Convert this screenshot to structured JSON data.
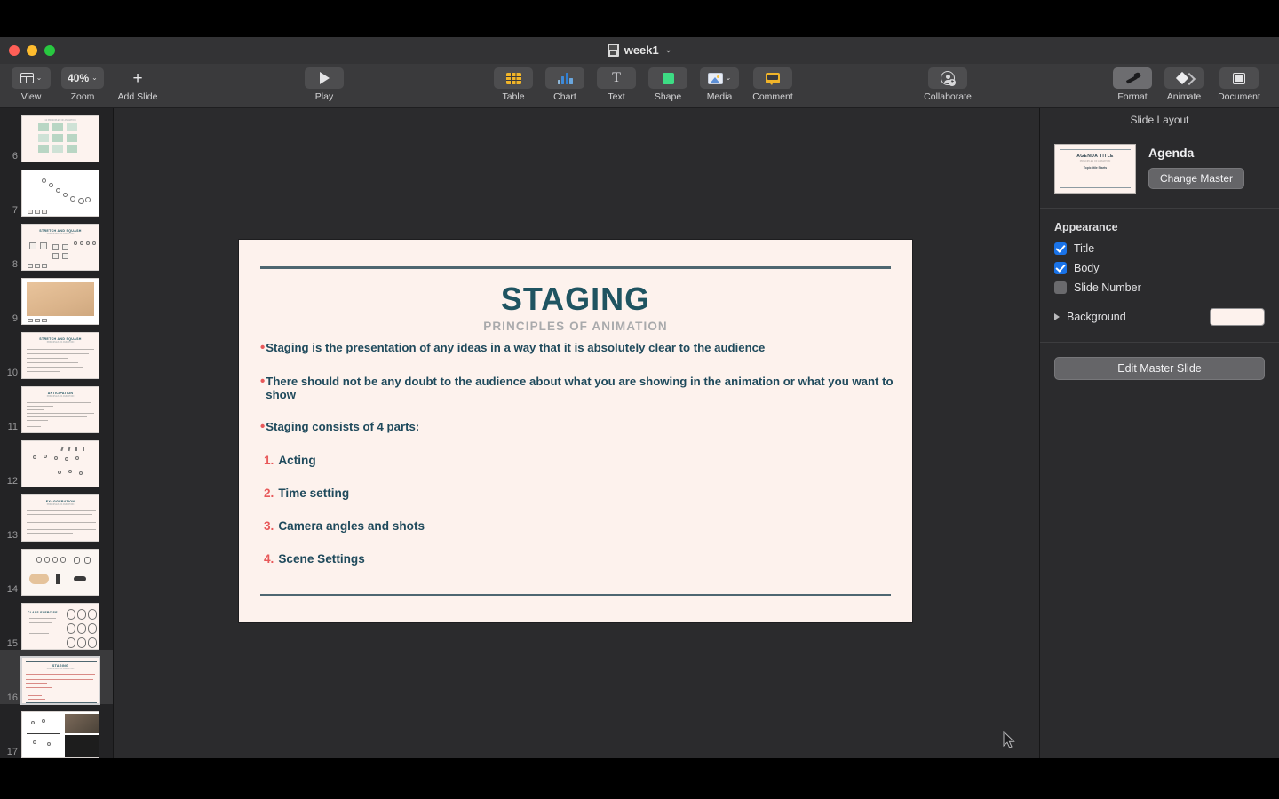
{
  "window": {
    "document_title": "week1",
    "title_chevron": "⌄"
  },
  "toolbar": {
    "left": [
      {
        "name": "view",
        "label": "View",
        "icon": "layout-icon",
        "has_chevron": true
      },
      {
        "name": "zoom",
        "label": "Zoom",
        "value": "40%",
        "icon": "zoom-value",
        "has_chevron": true
      },
      {
        "name": "add-slide",
        "label": "Add Slide",
        "icon": "plus-icon",
        "has_chevron": false
      }
    ],
    "play": {
      "label": "Play",
      "icon": "play-icon"
    },
    "insert": [
      {
        "name": "table",
        "label": "Table",
        "icon": "table-icon",
        "has_chevron": false
      },
      {
        "name": "chart",
        "label": "Chart",
        "icon": "chart-icon",
        "has_chevron": false
      },
      {
        "name": "text",
        "label": "Text",
        "icon": "text-icon",
        "has_chevron": false
      },
      {
        "name": "shape",
        "label": "Shape",
        "icon": "shape-icon",
        "has_chevron": false
      },
      {
        "name": "media",
        "label": "Media",
        "icon": "media-icon",
        "has_chevron": true
      },
      {
        "name": "comment",
        "label": "Comment",
        "icon": "comment-icon",
        "has_chevron": false
      }
    ],
    "collaborate": {
      "label": "Collaborate",
      "icon": "collaborate-icon"
    },
    "right": [
      {
        "name": "format",
        "label": "Format",
        "icon": "format-brush-icon",
        "active": true
      },
      {
        "name": "animate",
        "label": "Animate",
        "icon": "animate-diamond-icon",
        "active": false
      },
      {
        "name": "document",
        "label": "Document",
        "icon": "document-icon",
        "active": false
      }
    ]
  },
  "navigator": {
    "slides": [
      {
        "number": "6",
        "kind": "grid-icons",
        "title": ""
      },
      {
        "number": "7",
        "kind": "sketch-arc",
        "title": ""
      },
      {
        "number": "8",
        "kind": "titled-diagram",
        "title": "STRETCH AND SQUASH"
      },
      {
        "number": "9",
        "kind": "photo-tan",
        "title": ""
      },
      {
        "number": "10",
        "kind": "titled-text",
        "title": "STRETCH AND SQUASH"
      },
      {
        "number": "11",
        "kind": "titled-text",
        "title": "ANTICIPATION"
      },
      {
        "number": "12",
        "kind": "sketch-figures",
        "title": ""
      },
      {
        "number": "13",
        "kind": "titled-text",
        "title": "EXAGGERATION"
      },
      {
        "number": "14",
        "kind": "sketch-faces",
        "title": ""
      },
      {
        "number": "15",
        "kind": "exercise-faces",
        "title": "CLASS EXERCISE"
      },
      {
        "number": "16",
        "kind": "titled-text",
        "title": "STAGING",
        "selected": true
      },
      {
        "number": "17",
        "kind": "photo-collage",
        "title": ""
      }
    ]
  },
  "slide": {
    "title": "STAGING",
    "subtitle": "PRINCIPLES OF ANIMATION",
    "bullets": [
      {
        "marker": "•",
        "text": "Staging is the presentation of any ideas in a way that it is absolutely clear to the audience"
      },
      {
        "marker": "•",
        "text": "There should not be any doubt to the audience about what you are showing in the animation or what you want to show"
      },
      {
        "marker": "•",
        "text": "Staging consists of 4 parts:"
      }
    ],
    "numbered": [
      {
        "number": "1.",
        "text": "Acting"
      },
      {
        "number": "2.",
        "text": "Time setting"
      },
      {
        "number": "3.",
        "text": "Camera angles and shots"
      },
      {
        "number": "4.",
        "text": "Scene Settings"
      }
    ],
    "colors": {
      "background": "#fdf2ed",
      "title": "#1f5461",
      "subtitle": "#a9aaac",
      "body": "#1f4a5c",
      "accent": "#e8595a",
      "rule": "#4e6771"
    }
  },
  "inspector": {
    "header": "Slide Layout",
    "master": {
      "name": "Agenda",
      "change_button": "Change Master",
      "thumb_title": "AGENDA TITLE",
      "thumb_sub": "PRINCIPLES OF ANIMATION",
      "thumb_sub2": "Topic title Starts"
    },
    "appearance": {
      "title": "Appearance",
      "options": [
        {
          "label": "Title",
          "checked": true
        },
        {
          "label": "Body",
          "checked": true
        },
        {
          "label": "Slide Number",
          "checked": false
        }
      ]
    },
    "background": {
      "label": "Background",
      "swatch_color": "#fdf2ed"
    },
    "edit_master_button": "Edit Master Slide"
  }
}
